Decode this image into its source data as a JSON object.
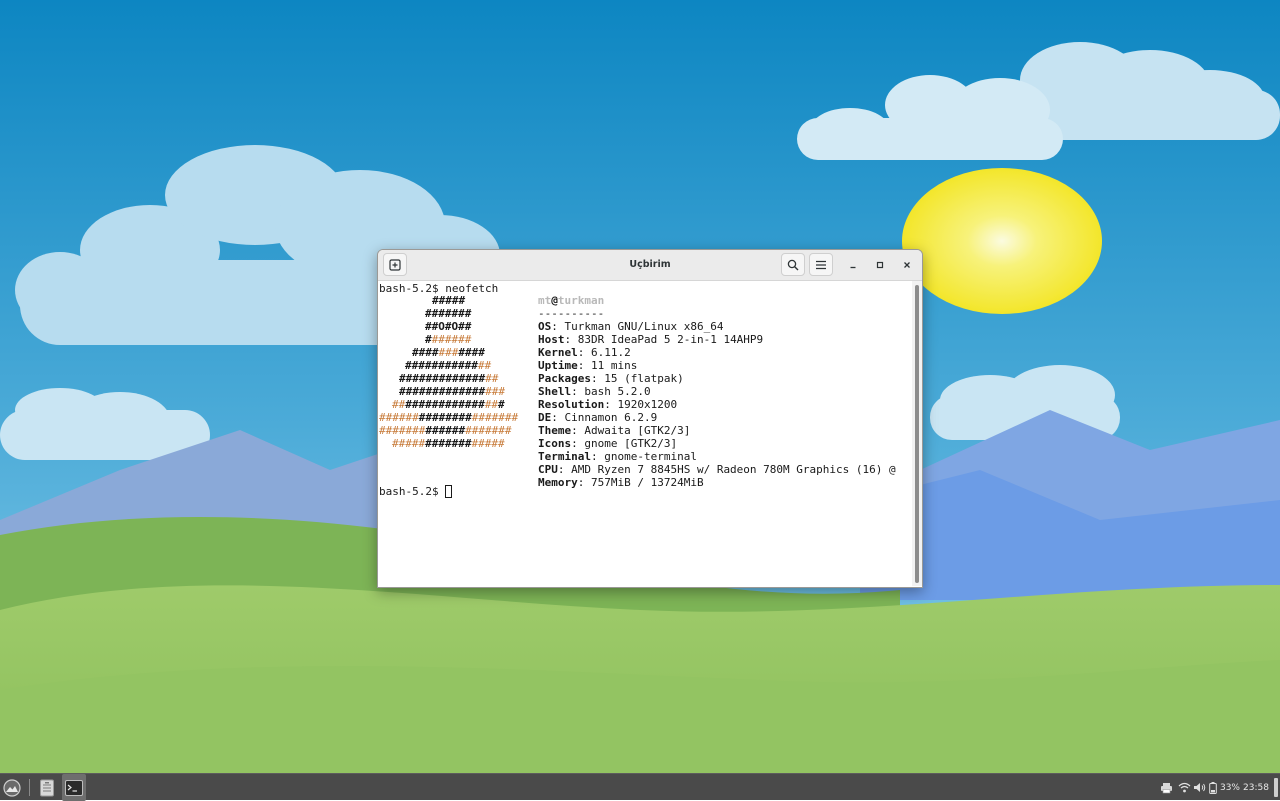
{
  "window": {
    "title": "Uçbirim",
    "new_tab_icon": "new-tab-icon",
    "search_icon": "search-icon",
    "menu_icon": "hamburger-menu-icon"
  },
  "terminal": {
    "command_line": "bash-5.2$ neofetch",
    "prompt": "bash-5.2$ ",
    "logo_color": "#c77a38",
    "user": "mt",
    "at": "@",
    "host": "turkman",
    "separator": "----------",
    "info": [
      {
        "key": "OS",
        "value": ": Turkman GNU/Linux x86_64"
      },
      {
        "key": "Host",
        "value": ": 83DR IdeaPad 5 2-in-1 14AHP9"
      },
      {
        "key": "Kernel",
        "value": ": 6.11.2"
      },
      {
        "key": "Uptime",
        "value": ": 11 mins"
      },
      {
        "key": "Packages",
        "value": ": 15 (flatpak)"
      },
      {
        "key": "Shell",
        "value": ": bash 5.2.0"
      },
      {
        "key": "Resolution",
        "value": ": 1920x1200"
      },
      {
        "key": "DE",
        "value": ": Cinnamon 6.2.9"
      },
      {
        "key": "Theme",
        "value": ": Adwaita [GTK2/3]"
      },
      {
        "key": "Icons",
        "value": ": gnome [GTK2/3]"
      },
      {
        "key": "Terminal",
        "value": ": gnome-terminal"
      },
      {
        "key": "CPU",
        "value": ": AMD Ryzen 7 8845HS w/ Radeon 780M Graphics (16) @"
      },
      {
        "key": "Memory",
        "value": ": 757MiB / 13724MiB"
      }
    ]
  },
  "panel": {
    "battery": "33%",
    "clock": "23:58"
  }
}
